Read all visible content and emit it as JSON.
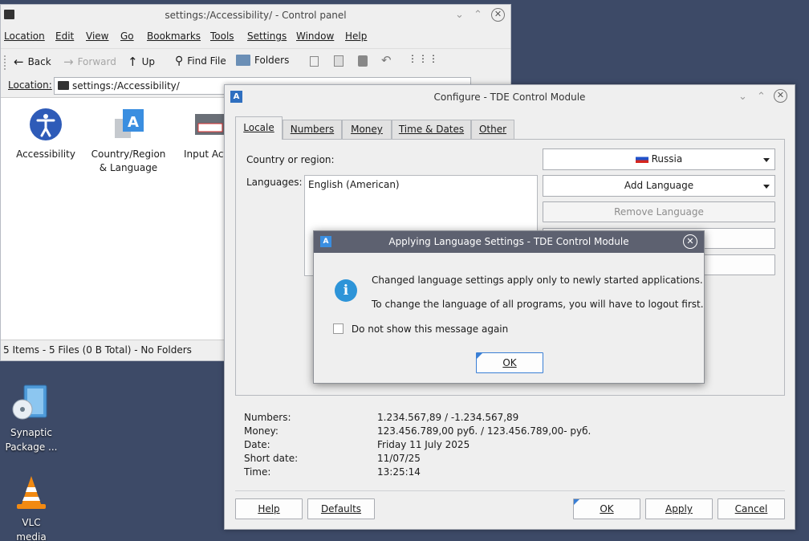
{
  "desktop": {
    "icons": [
      {
        "label": "Synaptic Package ..."
      },
      {
        "label": "VLC media pl..."
      }
    ]
  },
  "file_manager": {
    "title": "settings:/Accessibility/ - Control panel",
    "menu": [
      "Location",
      "Edit",
      "View",
      "Go",
      "Bookmarks",
      "Tools",
      "Settings",
      "Window",
      "Help"
    ],
    "toolbar": {
      "back": "Back",
      "forward": "Forward",
      "up": "Up",
      "find_file": "Find File",
      "folders": "Folders"
    },
    "location_label": "Location:",
    "location_value": "settings:/Accessibility/",
    "items": [
      {
        "label": "Accessibility"
      },
      {
        "label": "Country/Region & Language"
      },
      {
        "label": "Input Act"
      }
    ],
    "status": "5 Items - 5 Files (0 B Total) - No Folders"
  },
  "config_dialog": {
    "title": "Configure - TDE Control Module",
    "tabs": [
      "Locale",
      "Numbers",
      "Money",
      "Time & Dates",
      "Other"
    ],
    "country_label": "Country or region:",
    "country_value": "Russia",
    "languages_label": "Languages:",
    "languages_list": [
      "English (American)"
    ],
    "add_language": "Add Language",
    "remove_language": "Remove Language",
    "preview": [
      {
        "label": "Numbers:",
        "value": "1.234.567,89 / -1.234.567,89"
      },
      {
        "label": "Money:",
        "value": "123.456.789,00 руб. / 123.456.789,00- руб."
      },
      {
        "label": "Date:",
        "value": "Friday 11 July 2025"
      },
      {
        "label": "Short date:",
        "value": "11/07/25"
      },
      {
        "label": "Time:",
        "value": "13:25:14"
      }
    ],
    "buttons": {
      "help": "Help",
      "defaults": "Defaults",
      "ok": "OK",
      "apply": "Apply",
      "cancel": "Cancel"
    }
  },
  "alert": {
    "title": "Applying Language Settings - TDE Control Module",
    "line1": "Changed language settings apply only to newly started applications.",
    "line2": "To change the language of all programs, you will have to logout first.",
    "checkbox": "Do not show this message again",
    "ok": "OK"
  },
  "colors": {
    "desktop": "#3d4a67",
    "accent": "#3a7fd5",
    "alert_titlebar": "#5d6170"
  }
}
